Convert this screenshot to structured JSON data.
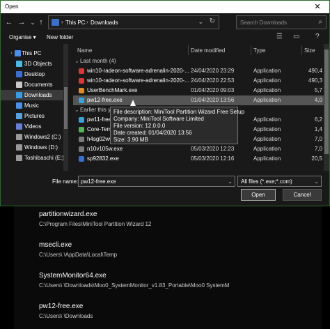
{
  "window": {
    "title": "Open",
    "close_glyph": "✕"
  },
  "nav": {
    "back": "←",
    "forward": "→",
    "down": "⌄",
    "up": "↑",
    "breadcrumb": [
      "This PC",
      "Downloads"
    ],
    "search_placeholder": "Search Downloads"
  },
  "toolbar": {
    "organise": "Organise ▾",
    "new_folder": "New folder"
  },
  "navpane": [
    {
      "label": "This PC",
      "color": "#4d8fe0",
      "selected": false
    },
    {
      "label": "3D Objects",
      "color": "#4db8e0",
      "selected": false
    },
    {
      "label": "Desktop",
      "color": "#3b6fc9",
      "selected": false
    },
    {
      "label": "Documents",
      "color": "#c9c9c9",
      "selected": false
    },
    {
      "label": "Downloads",
      "color": "#3b9be0",
      "selected": true
    },
    {
      "label": "Music",
      "color": "#4d8fe0",
      "selected": false
    },
    {
      "label": "Pictures",
      "color": "#5aa0d8",
      "selected": false
    },
    {
      "label": "Videos",
      "color": "#6a7fd0",
      "selected": false
    },
    {
      "label": "Windows2 (C:)",
      "color": "#9a9a9a",
      "selected": false
    },
    {
      "label": "Windows (D:)",
      "color": "#9a9a9a",
      "selected": false
    },
    {
      "label": "Toshibaschi (E:)",
      "color": "#9a9a9a",
      "selected": false
    }
  ],
  "columns": {
    "name": "Name",
    "date": "Date modified",
    "type": "Type",
    "size": "Size"
  },
  "groups": {
    "last_month": "Last month (4)",
    "earlier": "Earlier this year"
  },
  "files_last_month": [
    {
      "name": "win10-radeon-software-adrenalin-2020-...",
      "date": "24/04/2020 23:29",
      "type": "Application",
      "size": "490,4",
      "color": "#d23b3b"
    },
    {
      "name": "win10-radeon-software-adrenalin-2020-...",
      "date": "24/04/2020 22:53",
      "type": "Application",
      "size": "490,3",
      "color": "#d23b3b"
    },
    {
      "name": "UserBenchMark.exe",
      "date": "01/04/2020 09:03",
      "type": "Application",
      "size": "5,7",
      "color": "#e08b2e"
    },
    {
      "name": "pw12-free.exe",
      "date": "01/04/2020 13:56",
      "type": "Application",
      "size": "4,0",
      "color": "#3fa0d8"
    }
  ],
  "files_earlier": [
    {
      "name": "pw11-free",
      "date": "",
      "type": "Application",
      "size": "6,2",
      "color": "#3fa0d8"
    },
    {
      "name": "Core-Temp",
      "date": "",
      "type": "Application",
      "size": "1,4",
      "color": "#5bb05b"
    },
    {
      "name": "h4sg02ww",
      "date": "",
      "type": "Application",
      "size": "7,0",
      "color": "#7a7a7a"
    },
    {
      "name": "n10v105w.exe",
      "date": "05/03/2020 12:23",
      "type": "Application",
      "size": "7,0",
      "color": "#7a7a7a"
    },
    {
      "name": "sp92832.exe",
      "date": "05/03/2020 12:16",
      "type": "Application",
      "size": "20,5",
      "color": "#3b6fc9"
    }
  ],
  "tooltip": [
    "File description: MiniTool Partition Wizard Free Setup",
    "Company: MiniTool Software Limited",
    "File version: 12.0.0.0",
    "Date created: 01/04/2020 13:56",
    "Size: 3.90 MB"
  ],
  "footer": {
    "file_name_label": "File name:",
    "file_name_value": "pw12-free.exe",
    "filter_value": "All files (*.exe;*.com)",
    "open": "Open",
    "cancel": "Cancel"
  },
  "background_items": [
    {
      "name": "partitionwizard.exe",
      "path": "C:\\Program Files\\MiniTool Partition Wizard 12"
    },
    {
      "name": "msecli.exe",
      "path": "C:\\Users\\     \\AppData\\Local\\Temp"
    },
    {
      "name": "SystemMonitor64.exe",
      "path": "C:\\Users\\     \\Downloads\\Moo0_SystemMonitor_v1.83_Portable\\Moo0 SystemM"
    },
    {
      "name": "pw12-free.exe",
      "path": "C:\\Users\\     \\Downloads"
    }
  ]
}
